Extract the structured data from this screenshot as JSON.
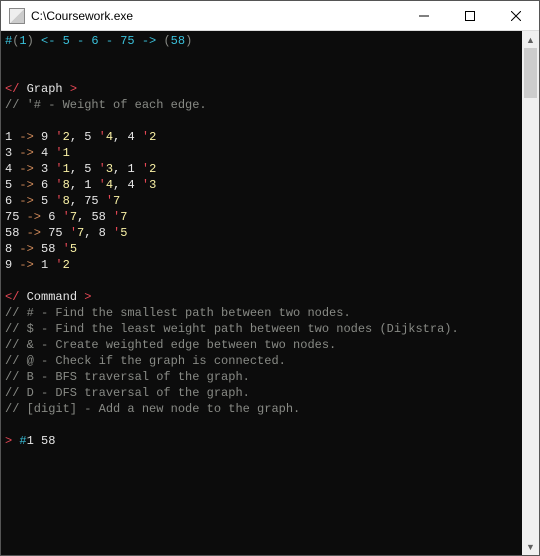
{
  "window": {
    "title": "C:\\Coursework.exe"
  },
  "header": {
    "hash": "#",
    "open_paren": "(",
    "current_node": "1",
    "close_paren": ")",
    "arrow_left": " <- ",
    "path": "5 - 6 - 75",
    "arrow_right": " -> ",
    "dest_open": "(",
    "dest_node": "58",
    "dest_close": ")"
  },
  "graph": {
    "tag_open": "</",
    "tag_name": " Graph ",
    "tag_close": ">",
    "legend_prefix": "// ",
    "legend": "'# - Weight of each edge.",
    "edges": [
      {
        "from": "1",
        "arrow": " -> ",
        "targets": [
          {
            "n": "9",
            "w": "2"
          },
          {
            "n": "5",
            "w": "4"
          },
          {
            "n": "4",
            "w": "2"
          }
        ]
      },
      {
        "from": "3",
        "arrow": " -> ",
        "targets": [
          {
            "n": "4",
            "w": "1"
          }
        ]
      },
      {
        "from": "4",
        "arrow": " -> ",
        "targets": [
          {
            "n": "3",
            "w": "1"
          },
          {
            "n": "5",
            "w": "3"
          },
          {
            "n": "1",
            "w": "2"
          }
        ]
      },
      {
        "from": "5",
        "arrow": " -> ",
        "targets": [
          {
            "n": "6",
            "w": "8"
          },
          {
            "n": "1",
            "w": "4"
          },
          {
            "n": "4",
            "w": "3"
          }
        ]
      },
      {
        "from": "6",
        "arrow": " -> ",
        "targets": [
          {
            "n": "5",
            "w": "8"
          },
          {
            "n": "75",
            "w": "7"
          }
        ]
      },
      {
        "from": "75",
        "arrow": " -> ",
        "targets": [
          {
            "n": "6",
            "w": "7"
          },
          {
            "n": "58",
            "w": "7"
          }
        ]
      },
      {
        "from": "58",
        "arrow": " -> ",
        "targets": [
          {
            "n": "75",
            "w": "7"
          },
          {
            "n": "8",
            "w": "5"
          }
        ]
      },
      {
        "from": "8",
        "arrow": " -> ",
        "targets": [
          {
            "n": "58",
            "w": "5"
          }
        ]
      },
      {
        "from": "9",
        "arrow": " -> ",
        "targets": [
          {
            "n": "1",
            "w": "2"
          }
        ]
      }
    ]
  },
  "command": {
    "tag_open": "</",
    "tag_name": " Command ",
    "tag_close": ">",
    "help_prefix": "// ",
    "help": [
      "# - Find the smallest path between two nodes.",
      "$ - Find the least weight path between two nodes (Dijkstra).",
      "& - Create weighted edge between two nodes.",
      "@ - Check if the graph is connected.",
      "B - BFS traversal of the graph.",
      "D - DFS traversal of the graph.",
      "[digit] - Add a new node to the graph."
    ]
  },
  "prompt": {
    "symbol": "> ",
    "command": "#",
    "arg1": "1",
    "space": " ",
    "arg2": "58"
  }
}
